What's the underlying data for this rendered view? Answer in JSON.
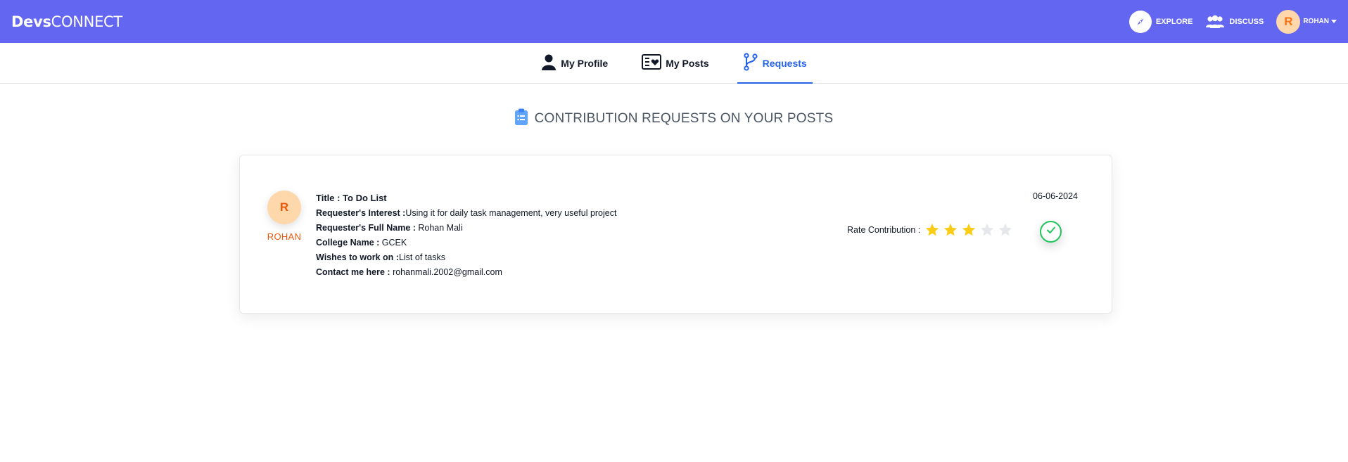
{
  "brand": {
    "part1": "Devs",
    "part2": "CONNECT"
  },
  "nav": {
    "explore": "EXPLORE",
    "discuss": "DISCUSS",
    "user_initial": "R",
    "user_name": "ROHAN"
  },
  "tabs": [
    {
      "label": "My Profile",
      "icon": "person-icon",
      "active": false
    },
    {
      "label": "My Posts",
      "icon": "posts-icon",
      "active": false
    },
    {
      "label": "Requests",
      "icon": "branch-icon",
      "active": true
    }
  ],
  "heading": {
    "text": "CONTRIBUTION REQUESTS ON YOUR POSTS",
    "icon": "clipboard-icon"
  },
  "request": {
    "avatar_initial": "R",
    "name": "ROHAN",
    "title": "Title : To Do List",
    "interest_label": "Requester's Interest :",
    "interest_value": "Using it for daily task management, very useful project",
    "fullname_label": "Requester's Full Name :",
    "fullname_value": " Rohan Mali",
    "college_label": "College Name :",
    "college_value": " GCEK",
    "work_label": "Wishes to work on :",
    "work_value": "List of tasks",
    "contact_label": "Contact me here :",
    "contact_value": " rohanmali.2002@gmail.com",
    "date": "06-06-2024",
    "rate_label": "Rate Contribution :",
    "rating": 3,
    "rating_max": 5
  },
  "colors": {
    "topbar": "#6366f1",
    "accent": "#2563eb",
    "avatar_bg": "#fed7aa",
    "avatar_text": "#ea580c",
    "star_filled": "#facc15",
    "star_empty": "#e5e7eb",
    "accept": "#22c55e"
  }
}
